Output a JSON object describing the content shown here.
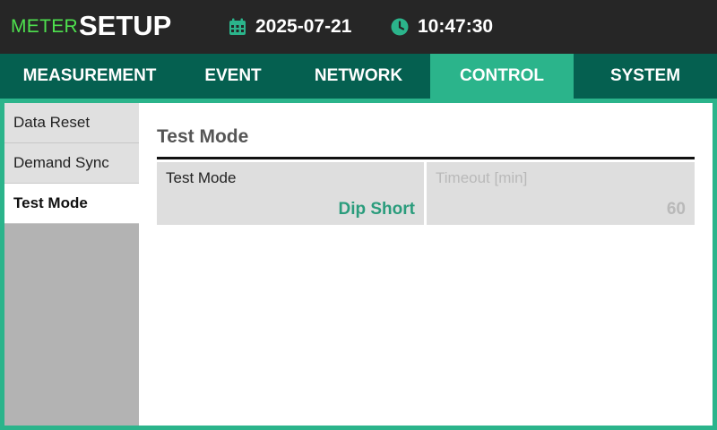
{
  "header": {
    "brand_prefix": "METER",
    "brand_title": "SETUP",
    "date": "2025-07-21",
    "time": "10:47:30",
    "date_icon": "calendar-icon",
    "time_icon": "clock-icon"
  },
  "tabs": [
    {
      "label": "MEASUREMENT",
      "active": false
    },
    {
      "label": "EVENT",
      "active": false
    },
    {
      "label": "NETWORK",
      "active": false
    },
    {
      "label": "CONTROL",
      "active": true
    },
    {
      "label": "SYSTEM",
      "active": false
    }
  ],
  "sidebar": {
    "items": [
      {
        "label": "Data Reset",
        "active": false
      },
      {
        "label": "Demand Sync",
        "active": false
      },
      {
        "label": "Test Mode",
        "active": true
      }
    ]
  },
  "main": {
    "title": "Test Mode",
    "fields": [
      {
        "label": "Test Mode",
        "value": "Dip Short",
        "enabled": true
      },
      {
        "label": "Timeout [min]",
        "value": "60",
        "enabled": false
      }
    ]
  },
  "colors": {
    "accent": "#2bb48b",
    "tab_bar": "#056050",
    "header_bg": "#262626",
    "brand_green": "#4ee04e",
    "value_green": "#2a9c7c"
  }
}
